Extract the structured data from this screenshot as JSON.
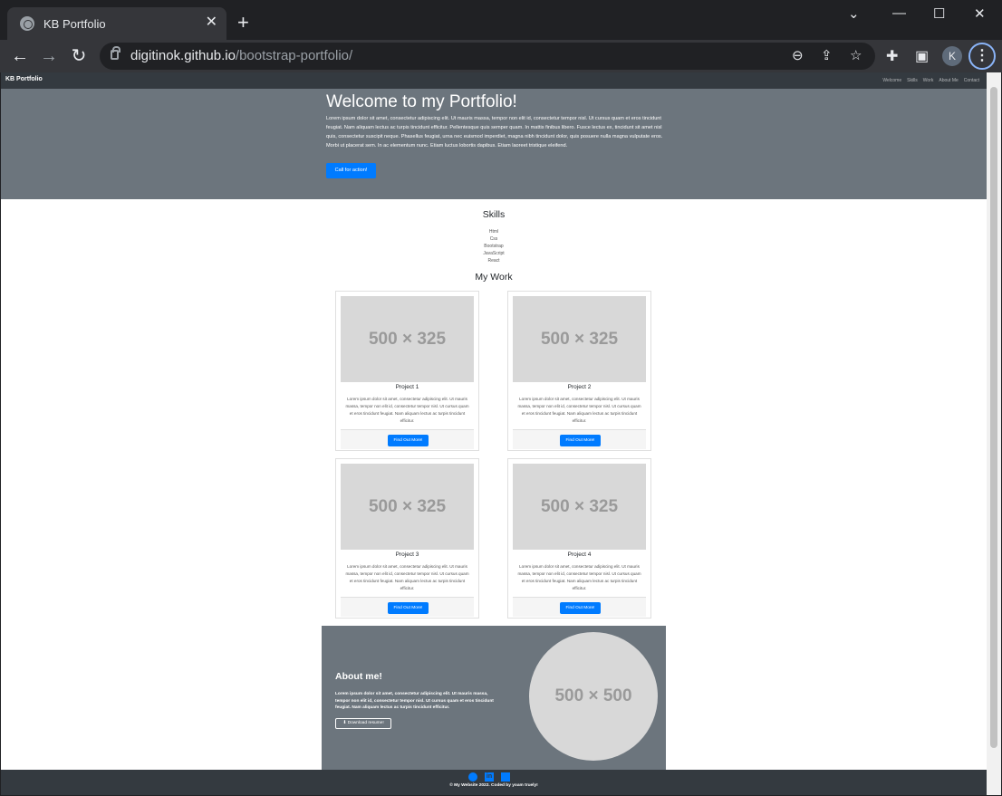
{
  "browser": {
    "tab_title": "KB Portfolio",
    "url_host": "digitinok.github.io",
    "url_path": "/bootstrap-portfolio/",
    "profile_initial": "K"
  },
  "site": {
    "brand": "KB Portfolio",
    "nav": [
      "Welcome",
      "Skills",
      "Work",
      "About Me",
      "Contact"
    ],
    "hero": {
      "title": "Welcome to my Portfolio!",
      "text": "Lorem ipsum dolor sit amet, consectetur adipiscing elit. Ut mauris massa, tempor non elit id, consectetur tempor nisl. Ut cursus quam et eros tincidunt feugiat. Nam aliquam lectus ac turpis tincidunt efficitur. Pellentesque quis semper quam. In mattis finibus libero. Fusce lectus ex, tincidunt sit amet nisl quis, consectetur suscipit neque. Phasellus feugiat, urna nec euismod imperdiet, magna nibh tincidunt dolor, quis posuere nulla magna vulputate eros. Morbi ut placerat sem. In ac elementum nunc. Etiam luctus lobortis dapibus. Etiam laoreet tristique eleifend.",
      "cta": "Call for action!"
    },
    "skills": {
      "title": "Skills",
      "items": [
        "Html",
        "Css",
        "Bootstrap",
        "JavaScript",
        "React"
      ]
    },
    "work": {
      "title": "My Work",
      "placeholder": "500 × 325",
      "projects": [
        {
          "title": "Project 1",
          "desc": "Lorem ipsum dolor sit amet, consectetur adipiscing elit. Ut mauris massa, tempor non elit id, consectetur tempor nisl. Ut cursus quam et eros tincidunt feugiat. Nam aliquam lectus ac turpis tincidunt efficitur.",
          "button": "Find Out More!"
        },
        {
          "title": "Project 2",
          "desc": "Lorem ipsum dolor sit amet, consectetur adipiscing elit. Ut mauris massa, tempor non elit id, consectetur tempor nisl. Ut cursus quam et eros tincidunt feugiat. Nam aliquam lectus ac turpis tincidunt efficitur.",
          "button": "Find Out More!"
        },
        {
          "title": "Project 3",
          "desc": "Lorem ipsum dolor sit amet, consectetur adipiscing elit. Ut mauris massa, tempor non elit id, consectetur tempor nisl. Ut cursus quam et eros tincidunt feugiat. Nam aliquam lectus ac turpis tincidunt efficitur.",
          "button": "Find Out More!"
        },
        {
          "title": "Project 4",
          "desc": "Lorem ipsum dolor sit amet, consectetur adipiscing elit. Ut mauris massa, tempor non elit id, consectetur tempor nisl. Ut cursus quam et eros tincidunt feugiat. Nam aliquam lectus ac turpis tincidunt efficitur.",
          "button": "Find Out More!"
        }
      ]
    },
    "about": {
      "title": "About me!",
      "text": "Lorem ipsum dolor sit amet, consectetur adipiscing elit. Ut mauris massa, tempor non elit id, consectetur tempor nisl. Ut cursus quam et eros tincidunt feugiat. Nam aliquam lectus ac turpis tincidunt efficitur.",
      "resume_button": "Download resume!",
      "image_placeholder": "500 × 500"
    },
    "footer": {
      "social_icons": [
        "github-icon",
        "linkedin-icon",
        "twitter-icon"
      ],
      "copyright": "© My Website 2022. Coded by yoam truely!"
    }
  },
  "colors": {
    "primary": "#007bff",
    "nav_dark": "#343a40",
    "hero_gray": "#6c757d"
  }
}
